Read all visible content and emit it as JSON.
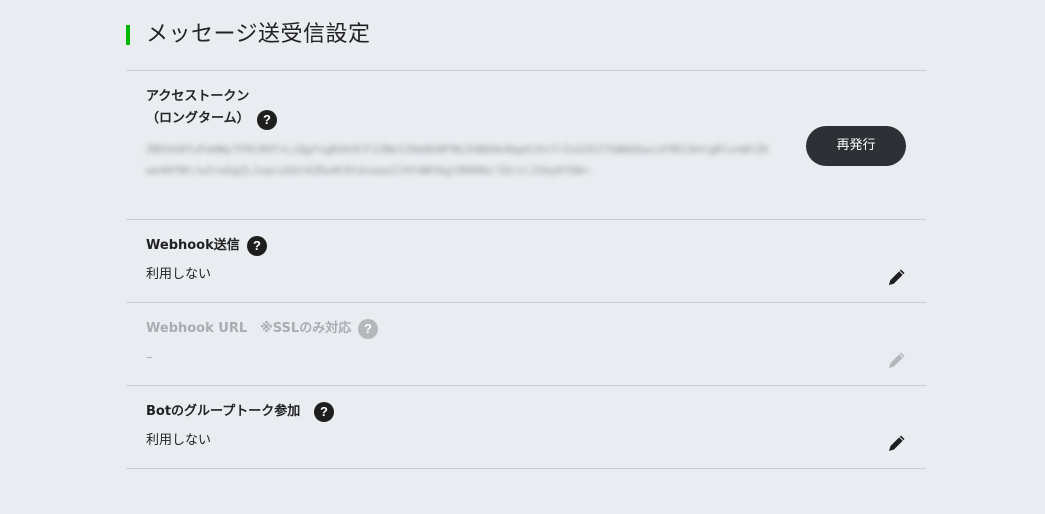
{
  "page": {
    "title": "メッセージ送受信設定",
    "accent_color": "#00b900"
  },
  "access_token": {
    "label_line1": "アクセストークン",
    "label_line2": "（ロングターム）",
    "help_icon": "question-circle-icon",
    "value_masked": "ZN5hG0fuFeHWy7FRC89T+LiQgfvgKGhXCF1ZNe1Z0m8G0F0bJhBbHk4bpXiVs7rZsG2UJ7kWQdGwcsF0ECbhtgRlvnWtZDwe40fWt/wIrwSgZLJvpcuGbt42Dw4C0tdvwaoIJ4fdWtKgt0000b/1O/vlJ2myKfQA=",
    "reissue_label": "再発行"
  },
  "webhook_send": {
    "label": "Webhook送信",
    "help_icon": "question-circle-icon",
    "value": "利用しない",
    "edit_icon": "pencil-icon"
  },
  "webhook_url": {
    "label": "Webhook URL　※SSLのみ対応",
    "help_icon": "question-circle-icon",
    "value": "–",
    "edit_icon": "pencil-icon",
    "disabled_color": "#a9adb2"
  },
  "bot_group": {
    "label": "Botのグループトーク参加",
    "help_icon": "question-circle-icon",
    "value": "利用しない",
    "edit_icon": "pencil-icon"
  },
  "colors": {
    "background": "#e9ecf0",
    "button_dark": "#2d3035",
    "divider": "#c9cdd2"
  }
}
